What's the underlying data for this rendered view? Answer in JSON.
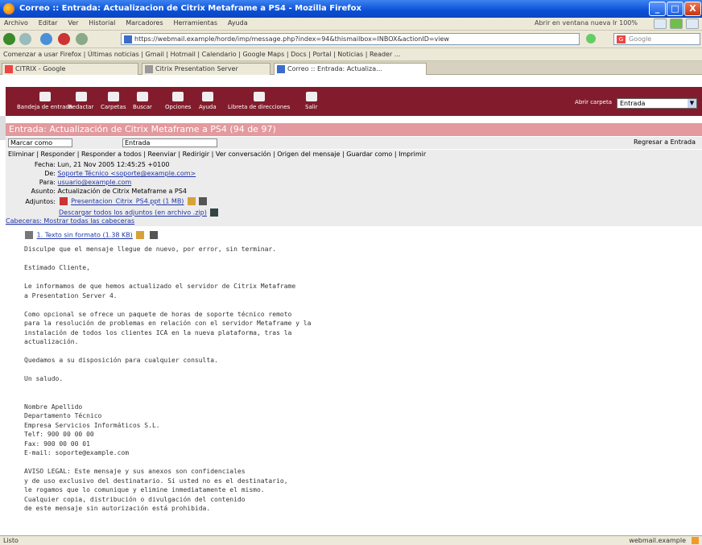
{
  "window": {
    "title": "Correo :: Entrada: Actualizacion de Citrix Metaframe a PS4 - Mozilla Firefox",
    "min": "_",
    "max": "□",
    "close": "X"
  },
  "menu": {
    "items": [
      "Archivo",
      "Editar",
      "Ver",
      "Historial",
      "Marcadores",
      "Herramientas",
      "Ayuda"
    ],
    "right_text": "Abrir en ventana nueva  Ir 100%"
  },
  "nav": {
    "url": "https://webmail.example/horde/imp/message.php?index=94&thismailbox=INBOX&actionID=view",
    "search_placeholder": "Google",
    "search_icon_text": "G"
  },
  "bookmarks": {
    "text": "Comenzar a usar Firefox | Últimas noticias | Gmail | Hotmail | Calendario | Google Maps | Docs | Portal | Noticias | Reader ..."
  },
  "tabs": [
    {
      "label": "CITRIX - Google"
    },
    {
      "label": "Citrix Presentation Server"
    },
    {
      "label": "Correo :: Entrada: Actualiza..."
    }
  ],
  "app": {
    "toolbar": [
      "Bandeja de entrada",
      "Redactar",
      "Carpetas",
      "Buscar",
      "Opciones",
      "Ayuda",
      "Libreta de direcciones",
      "Salir"
    ],
    "lang_label": "Abrir carpeta",
    "lang_value": "Entrada",
    "lang_arrow": "▼"
  },
  "message": {
    "subject": "Entrada: Actualización de Citrix Metaframe a PS4 (94 de 97)",
    "mark_as": "Marcar como",
    "move_to": "Entrada",
    "actions": "Eliminar | Responder | Responder a todos | Reenviar | Redirigir | Ver conversación | Origen del mensaje | Guardar como | Imprimir",
    "back_link": "Regresar a Entrada",
    "headers": [
      {
        "label": "Fecha:",
        "value": "Lun, 21 Nov 2005 12:45:25 +0100",
        "link": false
      },
      {
        "label": "De:",
        "value": "Soporte Técnico <soporte@example.com>",
        "link": true
      },
      {
        "label": "Para:",
        "value": "usuario@example.com",
        "link": true
      },
      {
        "label": "Asunto:",
        "value": "Actualización de Citrix Metaframe a PS4",
        "link": false
      },
      {
        "label": "Adjuntos:",
        "value": "Presentacion_Citrix_PS4.ppt (1 MB)",
        "link": true
      },
      {
        "label": "",
        "value": "Descargar todos los adjuntos (en archivo .zip)",
        "link": true
      }
    ],
    "headers_footer": "Cabeceras: Mostrar todas las cabeceras",
    "part_label": "1. Texto sin formato (1.38 KB)",
    "body_lines": [
      "Disculpe que el mensaje llegue de nuevo, por error, sin terminar.",
      "",
      "Estimado Cliente,",
      "",
      "Le informamos de que hemos actualizado el servidor de Citrix Metaframe",
      "a Presentation Server 4.",
      "",
      "Como opcional se ofrece un paquete de horas de soporte técnico remoto",
      "para la resolución de problemas en relación con el servidor Metaframe y la",
      "instalación de todos los clientes ICA en la nueva plataforma, tras la",
      "actualización.",
      "",
      "Quedamos a su disposición para cualquier consulta.",
      "",
      "Un saludo.",
      "",
      "",
      "Nombre Apellido",
      "Departamento Técnico",
      "Empresa Servicios Informáticos S.L.",
      "Telf: 900 00 00 00",
      "Fax: 900 00 00 01",
      "E-mail: soporte@example.com",
      "",
      "AVISO LEGAL: Este mensaje y sus anexos son confidenciales",
      "y de uso exclusivo del destinatario. Si usted no es el destinatario,",
      "le rogamos que lo comunique y elimine inmediatamente el mismo.",
      "Cualquier copia, distribución o divulgación del contenido",
      "de este mensaje sin autorización está prohibida."
    ]
  },
  "status": {
    "left": "Listo",
    "right": "webmail.example"
  }
}
